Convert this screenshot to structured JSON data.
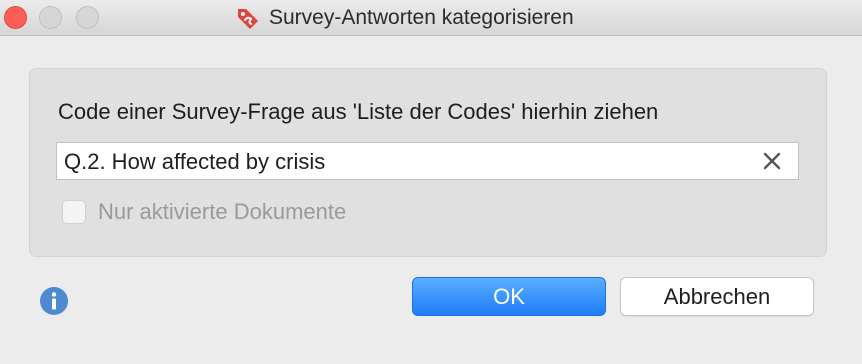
{
  "window": {
    "title": "Survey-Antworten kategorisieren",
    "app_icon": "tag-icon"
  },
  "panel": {
    "instruction": "Code einer Survey-Frage aus 'Liste der Codes' hierhin ziehen",
    "field_value": "Q.2. How affected by crisis",
    "clear_icon": "close-icon",
    "checkbox_label": "Nur aktivierte Dokumente",
    "checkbox_checked": false,
    "checkbox_enabled": false
  },
  "footer": {
    "info_icon": "info-icon",
    "ok_label": "OK",
    "cancel_label": "Abbrechen"
  },
  "colors": {
    "accent": "#1f7dfa",
    "close_dot": "#fc5f57",
    "app_icon": "#e0443a",
    "info": "#4d8ad0"
  }
}
